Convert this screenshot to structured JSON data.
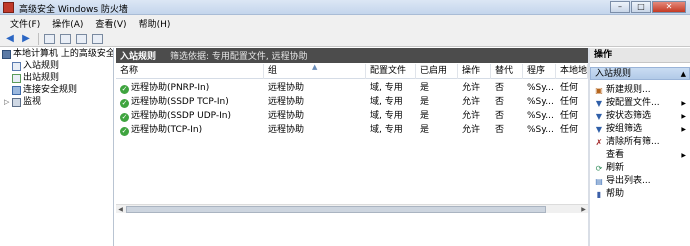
{
  "window": {
    "title": "高级安全 Windows 防火墙"
  },
  "menu": [
    "文件(F)",
    "操作(A)",
    "查看(V)",
    "帮助(H)"
  ],
  "tree": {
    "root": "本地计算机 上的高级安全",
    "items": [
      "入站规则",
      "出站规则",
      "连接安全规则",
      "监视"
    ]
  },
  "main": {
    "title": "入站规则",
    "filter": "筛选依据: 专用配置文件, 远程协助"
  },
  "table": {
    "headers": [
      "名称",
      "组",
      "配置文件",
      "已启用",
      "操作",
      "替代",
      "程序",
      "本地地"
    ],
    "rows": [
      [
        "远程协助(PNRP-In)",
        "远程协助",
        "域, 专用",
        "是",
        "允许",
        "否",
        "%Sy...",
        "任何"
      ],
      [
        "远程协助(SSDP TCP-In)",
        "远程协助",
        "域, 专用",
        "是",
        "允许",
        "否",
        "%Sy...",
        "任何"
      ],
      [
        "远程协助(SSDP UDP-In)",
        "远程协助",
        "域, 专用",
        "是",
        "允许",
        "否",
        "%Sy...",
        "任何"
      ],
      [
        "远程协助(TCP-In)",
        "远程协助",
        "域, 专用",
        "是",
        "允许",
        "否",
        "%Sy...",
        "任何"
      ]
    ]
  },
  "actions": {
    "header": "操作",
    "section": "入站规则",
    "items": [
      "新建规则...",
      "按配置文件...",
      "按状态筛选",
      "按组筛选",
      "清除所有筛...",
      "查看",
      "刷新",
      "导出列表...",
      "帮助"
    ]
  }
}
